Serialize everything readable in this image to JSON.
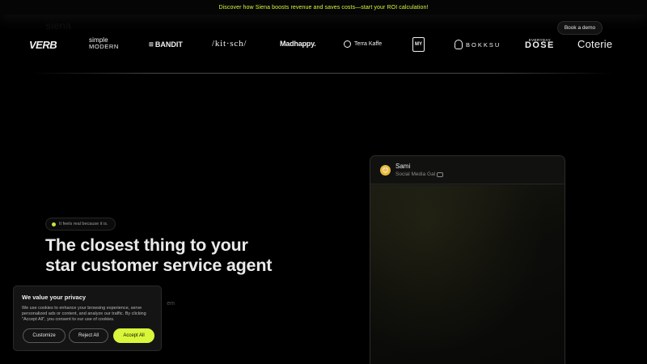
{
  "announcement": {
    "text": "Discover how Siena boosts revenue and saves costs—start your ROI calculation!"
  },
  "header": {
    "logo": "siena",
    "book_demo": "Book a demo"
  },
  "brands": {
    "verb": "VERB",
    "simple_top": "simple",
    "simple_bottom": "MODERN",
    "bandit_mark": "⊞",
    "bandit": "BANDIT",
    "kitsch": "/kit·sch/",
    "madhappy": "Madhappy.",
    "terra": "Terra Kaffe",
    "boxmark": "MY",
    "bokksu": "BOKKSU",
    "dose_top": "EVERYDAY",
    "dose": "DOSE",
    "coterie": "Coterie"
  },
  "hero": {
    "tag": "It feels real because it is.",
    "title_line1": "The closest thing to your",
    "title_line2": "star customer service agent",
    "subtitle_fragment": "em"
  },
  "chat_preview": {
    "avatar": "😊",
    "name": "Sami",
    "role": "Social Media Gal"
  },
  "cookie": {
    "title": "We value your privacy",
    "text": "We use cookies to enhance your browsing experience, serve personalized ads or content, and analyze our traffic. By clicking \"Accept All\", you consent to our use of cookies.",
    "customize": "Customize",
    "reject": "Reject All",
    "accept": "Accept All"
  },
  "colors": {
    "accent": "#d9f63a",
    "background": "#000000"
  }
}
